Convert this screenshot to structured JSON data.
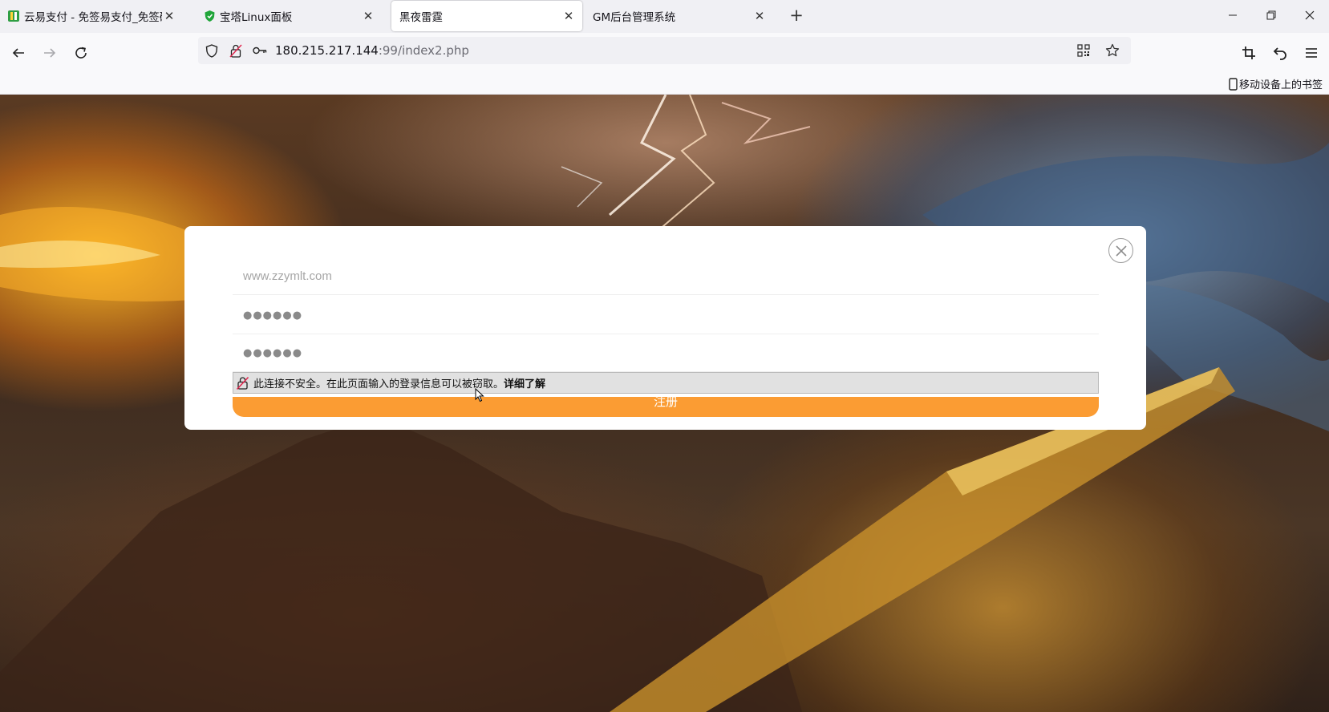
{
  "tabs": [
    {
      "title": "云易支付 - 免签易支付_免签码支",
      "icon": "yunyi-favicon",
      "active": false
    },
    {
      "title": "宝塔Linux面板",
      "icon": "baota-shield-icon",
      "active": false
    },
    {
      "title": "黑夜雷霆",
      "icon": "none",
      "active": true
    },
    {
      "title": "GM后台管理系统",
      "icon": "none",
      "active": false
    }
  ],
  "newtab_label": "+",
  "address": {
    "host": "180.215.217.144",
    "rest": ":99/index2.php"
  },
  "bookmarks": {
    "mobile_label": "移动设备上的书签"
  },
  "form": {
    "username_placeholder": "www.zzymlt.com",
    "password_dots": "●●●●●●",
    "confirm_dots": "●●●●●●",
    "register_label": "注册"
  },
  "insecure_popup": {
    "message": "此连接不安全。在此页面输入的登录信息可以被窃取。",
    "learn_more": "详细了解"
  },
  "colors": {
    "accent_orange": "#fb9c33",
    "tabstrip_bg": "#f0f0f4",
    "navbar_bg": "#f9f9fb"
  }
}
